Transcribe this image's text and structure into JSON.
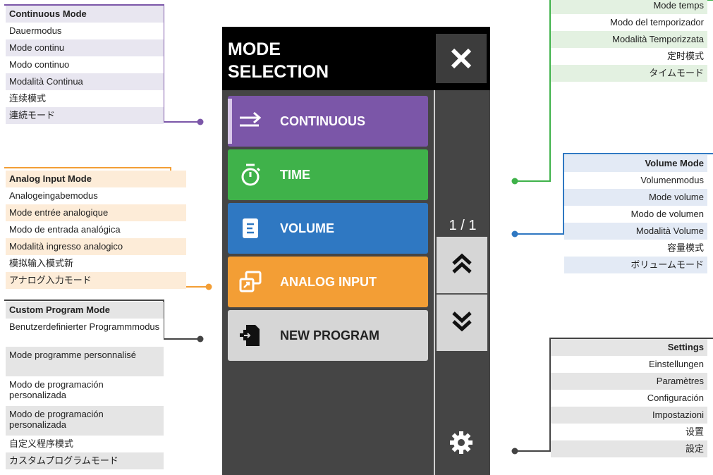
{
  "screen": {
    "title_line1": "MODE",
    "title_line2": "SELECTION",
    "page_indicator": "1 / 1",
    "modes": [
      {
        "label": "CONTINUOUS",
        "color": "#7b56a8",
        "icon": "arrow-right-icon"
      },
      {
        "label": "TIME",
        "color": "#3fb24a",
        "icon": "stopwatch-icon"
      },
      {
        "label": "VOLUME",
        "color": "#2f78c2",
        "icon": "document-icon"
      },
      {
        "label": "ANALOG INPUT",
        "color": "#f39e35",
        "icon": "overlapping-windows-icon"
      },
      {
        "label": "NEW PROGRAM",
        "color": "#d6d6d6",
        "icon": "new-file-icon"
      }
    ]
  },
  "callouts": {
    "continuous": {
      "accent": "#7b56a8",
      "items": [
        "Continuous Mode",
        "Dauermodus",
        "Mode continu",
        "Modo continuo",
        "Modalità Continua",
        "连续模式",
        "連続モード"
      ]
    },
    "analog": {
      "accent": "#f39e35",
      "items": [
        "Analog Input Mode",
        "Analogeingabemodus",
        "Mode entrée analogique",
        "Modo de entrada analógica",
        "Modalità ingresso analogico",
        "模拟输入模式新",
        "アナログ入力モード"
      ]
    },
    "custom": {
      "accent": "#444444",
      "items": [
        "Custom Program Mode",
        "Benutzerdefinierter Programmmodus",
        "Mode programme personnalisé",
        "Modo de programación personalizada",
        "Modo de programación personalizada",
        "自定义程序模式",
        "カスタムプログラムモード"
      ]
    },
    "time": {
      "accent": "#3fb24a",
      "items": [
        "Mode temps",
        "Modo del temporizador",
        "Modalità Temporizzata",
        "定时模式",
        "タイムモード"
      ]
    },
    "volume": {
      "accent": "#2f78c2",
      "items": [
        "Volume Mode",
        "Volumenmodus",
        "Mode volume",
        "Modo de volumen",
        "Modalità Volume",
        "容量模式",
        "ボリュームモード"
      ]
    },
    "settings": {
      "accent": "#444444",
      "items": [
        "Settings",
        "Einstellungen",
        "Paramètres",
        "Configuración",
        "Impostazioni",
        "设置",
        "設定"
      ]
    }
  }
}
